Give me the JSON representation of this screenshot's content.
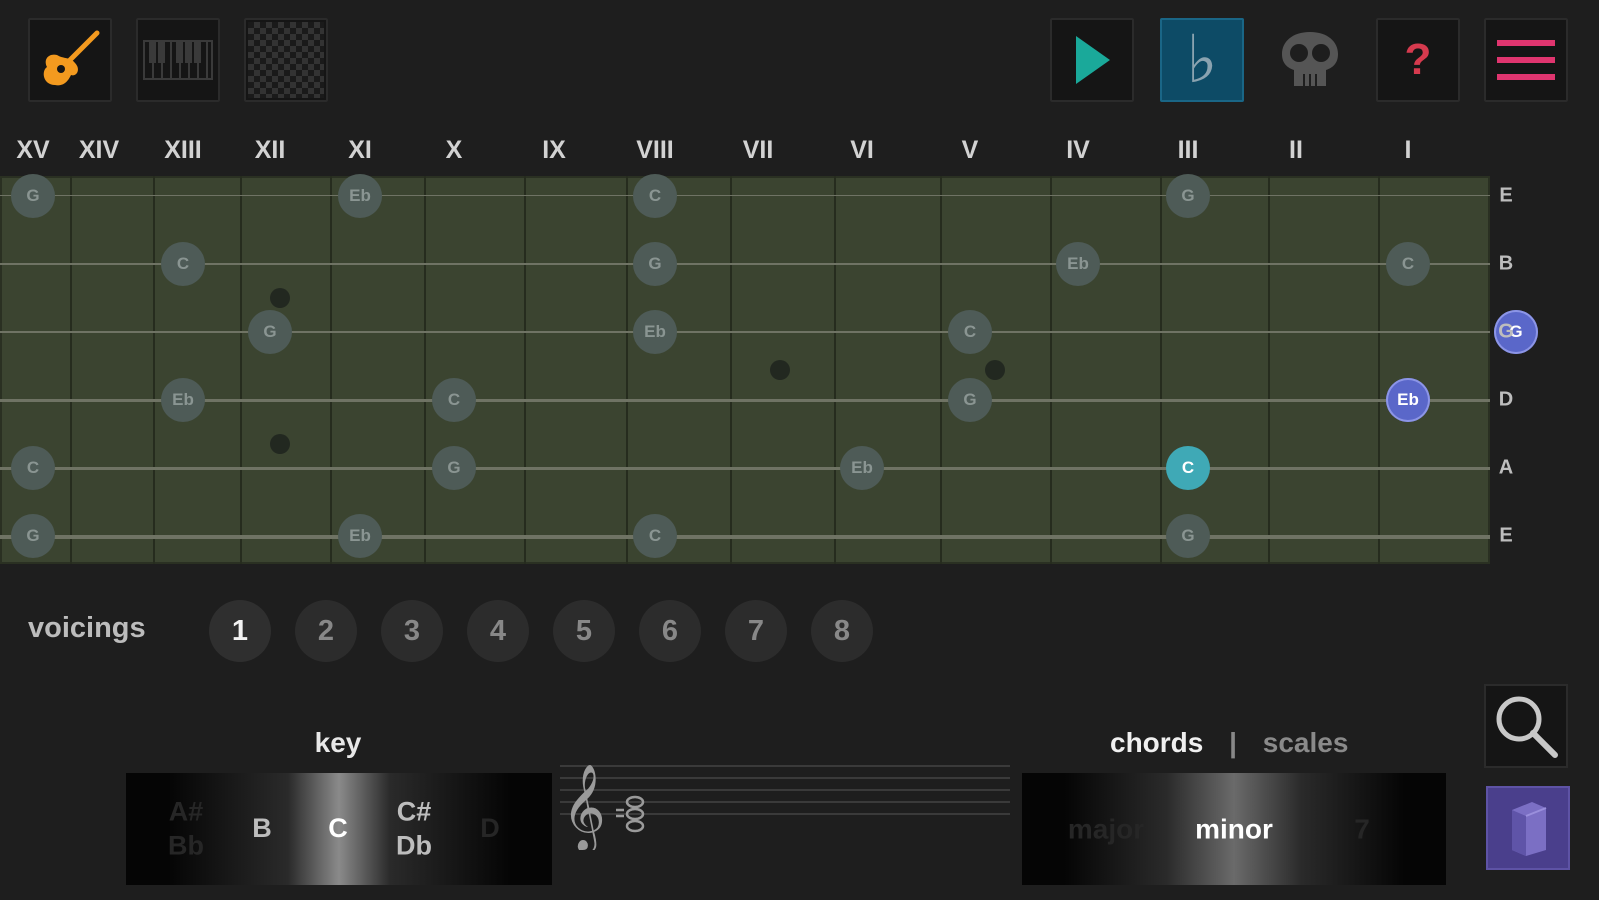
{
  "toolbar": {
    "left_buttons": [
      {
        "name": "guitar-mode-button",
        "icon": "guitar-icon"
      },
      {
        "name": "piano-mode-button",
        "icon": "piano-keys-icon"
      },
      {
        "name": "grid-mode-button",
        "icon": "checkerboard-icon"
      }
    ],
    "right_buttons": [
      {
        "name": "play-button",
        "icon": "play-icon"
      },
      {
        "name": "flat-toggle-button",
        "icon": "flat-icon",
        "label": "♭",
        "active": true
      },
      {
        "name": "skull-button",
        "icon": "skull-icon"
      },
      {
        "name": "help-button",
        "icon": "question-icon",
        "label": "?"
      },
      {
        "name": "menu-button",
        "icon": "hamburger-icon"
      }
    ]
  },
  "fret_labels": [
    "XV",
    "XIV",
    "XIII",
    "XII",
    "XI",
    "X",
    "IX",
    "VIII",
    "VII",
    "VI",
    "V",
    "IV",
    "III",
    "II",
    "I"
  ],
  "string_names": [
    "E",
    "B",
    "G",
    "D",
    "A",
    "E"
  ],
  "notes": [
    {
      "s": 0,
      "f": 15,
      "t": "G"
    },
    {
      "s": 0,
      "f": 11,
      "t": "Eb"
    },
    {
      "s": 0,
      "f": 8,
      "t": "C"
    },
    {
      "s": 0,
      "f": 3,
      "t": "G"
    },
    {
      "s": 1,
      "f": 13,
      "t": "C"
    },
    {
      "s": 1,
      "f": 8,
      "t": "G"
    },
    {
      "s": 1,
      "f": 4,
      "t": "Eb"
    },
    {
      "s": 1,
      "f": 1,
      "t": "C"
    },
    {
      "s": 2,
      "f": 12,
      "t": "G"
    },
    {
      "s": 2,
      "f": 8,
      "t": "Eb"
    },
    {
      "s": 2,
      "f": 5,
      "t": "C"
    },
    {
      "s": 2,
      "f": 0,
      "t": "G",
      "style": "blue"
    },
    {
      "s": 3,
      "f": 13,
      "t": "Eb"
    },
    {
      "s": 3,
      "f": 10,
      "t": "C"
    },
    {
      "s": 3,
      "f": 5,
      "t": "G"
    },
    {
      "s": 3,
      "f": 1,
      "t": "Eb",
      "style": "blue"
    },
    {
      "s": 4,
      "f": 15,
      "t": "C"
    },
    {
      "s": 4,
      "f": 10,
      "t": "G"
    },
    {
      "s": 4,
      "f": 6,
      "t": "Eb"
    },
    {
      "s": 4,
      "f": 3,
      "t": "C",
      "style": "teal"
    },
    {
      "s": 5,
      "f": 15,
      "t": "G"
    },
    {
      "s": 5,
      "f": 11,
      "t": "Eb"
    },
    {
      "s": 5,
      "f": 8,
      "t": "C"
    },
    {
      "s": 5,
      "f": 3,
      "t": "G"
    }
  ],
  "voicings": {
    "label": "voicings",
    "items": [
      "1",
      "2",
      "3",
      "4",
      "5",
      "6",
      "7",
      "8"
    ],
    "active": "1"
  },
  "key": {
    "label": "key",
    "items": [
      {
        "text": "A#\nBb",
        "state": "faded"
      },
      {
        "text": "B",
        "state": "normal"
      },
      {
        "text": "C",
        "state": "selected"
      },
      {
        "text": "C#\nDb",
        "state": "normal"
      },
      {
        "text": "D",
        "state": "faded"
      }
    ]
  },
  "mode": {
    "chords_label": "chords",
    "separator": "|",
    "scales_label": "scales",
    "items": [
      {
        "text": "major",
        "state": "faded"
      },
      {
        "text": "minor",
        "state": "selected"
      },
      {
        "text": "7",
        "state": "faded"
      }
    ]
  },
  "side_buttons": [
    {
      "name": "search-button",
      "icon": "search-icon"
    },
    {
      "name": "book-button",
      "icon": "book-icon"
    }
  ],
  "colors": {
    "fretboard": "#3b4430",
    "note": "#4e5b57",
    "teal": "#3fa9b6",
    "blue": "#5a67c9",
    "guitar": "#f39a1f",
    "play": "#1aa99a",
    "flat_bg": "#0d4b66",
    "menu": "#e0356f",
    "help": "#d63a4e"
  }
}
